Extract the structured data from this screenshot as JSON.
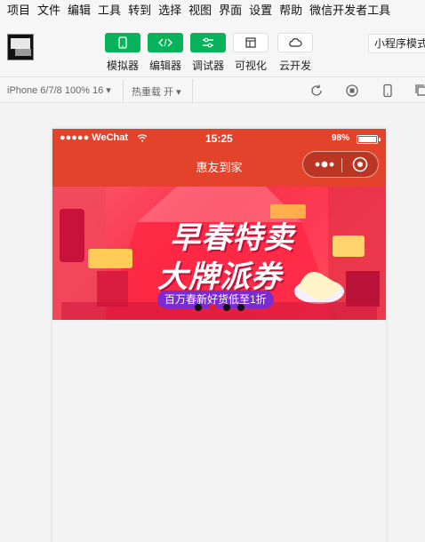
{
  "menu": [
    "项目",
    "文件",
    "编辑",
    "工具",
    "转到",
    "选择",
    "视图",
    "界面",
    "设置",
    "帮助",
    "微信开发者工具"
  ],
  "toolbar": {
    "buttons": [
      {
        "label": "模拟器",
        "icon": "phone-icon"
      },
      {
        "label": "编辑器",
        "icon": "code-icon"
      },
      {
        "label": "调试器",
        "icon": "debug-icon"
      },
      {
        "label": "可视化",
        "icon": "layout-icon"
      },
      {
        "label": "云开发",
        "icon": "cloud-icon"
      }
    ],
    "mode": "小程序模式"
  },
  "subbar": {
    "device": "iPhone 6/7/8 100% 16 ▾",
    "hot_reload": "热重载 开 ▾"
  },
  "phone": {
    "carrier": "●●●●● WeChat",
    "time": "15:25",
    "battery": "98%",
    "battery_level": 0.98,
    "title": "惠友到家"
  },
  "banner": {
    "line1": "早春特卖",
    "line2": "大牌派券",
    "sub": "百万春新好货低至1折",
    "dots": 4,
    "active_dot": 1
  },
  "colors": {
    "accent_green": "#07b35a",
    "header_red": "#e3422b"
  }
}
